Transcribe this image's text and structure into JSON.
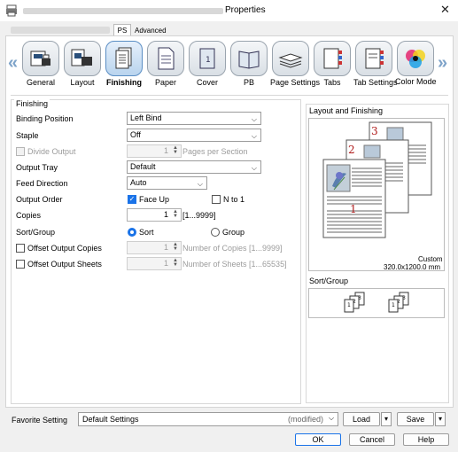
{
  "window": {
    "title": "Properties"
  },
  "tabs": {
    "active": "PS",
    "other": "Advanced"
  },
  "nav_items": [
    {
      "label": "General",
      "icon": "general-icon"
    },
    {
      "label": "Layout",
      "icon": "layout-icon"
    },
    {
      "label": "Finishing",
      "icon": "finishing-icon",
      "active": true
    },
    {
      "label": "Paper",
      "icon": "paper-icon"
    },
    {
      "label": "Cover",
      "icon": "cover-icon"
    },
    {
      "label": "PB",
      "icon": "pb-icon"
    },
    {
      "label": "Page Settings",
      "icon": "page-settings-icon"
    },
    {
      "label": "Tabs",
      "icon": "tabs-icon"
    },
    {
      "label": "Tab Settings",
      "icon": "tab-settings-icon"
    },
    {
      "label": "Color Mode",
      "icon": "color-mode-icon"
    }
  ],
  "finishing": {
    "group_title": "Finishing",
    "binding_position": {
      "label": "Binding Position",
      "value": "Left Bind"
    },
    "staple": {
      "label": "Staple",
      "value": "Off"
    },
    "divide_output": {
      "label": "Divide Output",
      "value": "1",
      "suffix": "Pages per Section",
      "checked": false,
      "enabled": false
    },
    "output_tray": {
      "label": "Output Tray",
      "value": "Default"
    },
    "feed_direction": {
      "label": "Feed Direction",
      "value": "Auto"
    },
    "output_order": {
      "label": "Output Order",
      "face_up": "Face Up",
      "face_up_checked": true,
      "n_to_1": "N to 1",
      "n_to_1_checked": false
    },
    "copies": {
      "label": "Copies",
      "value": "1",
      "range": "[1...9999]"
    },
    "sort_group": {
      "label": "Sort/Group",
      "sort": "Sort",
      "group": "Group",
      "selected": "Sort"
    },
    "offset_copies": {
      "label": "Offset Output Copies",
      "value": "1",
      "suffix": "Number of Copies [1...9999]",
      "checked": false
    },
    "offset_sheets": {
      "label": "Offset Output Sheets",
      "value": "1",
      "suffix": "Number of Sheets [1...65535]",
      "checked": false
    }
  },
  "layout_preview": {
    "title": "Layout and Finishing",
    "page_numbers": [
      "3",
      "2",
      "1"
    ],
    "paper_name": "Custom",
    "paper_size": "320.0x1200.0 mm",
    "sort_title": "Sort/Group",
    "sort_stack": [
      "1",
      "2",
      "3"
    ]
  },
  "bottom": {
    "favorite_label": "Favorite Setting",
    "favorite_value": "Default Settings",
    "favorite_state": "(modified)",
    "load": "Load",
    "save": "Save",
    "ok": "OK",
    "cancel": "Cancel",
    "help": "Help"
  },
  "colors": {
    "accent": "#1a73e8",
    "page_number": "#b01c1c",
    "nav_arrow": "#7ea3c9"
  }
}
